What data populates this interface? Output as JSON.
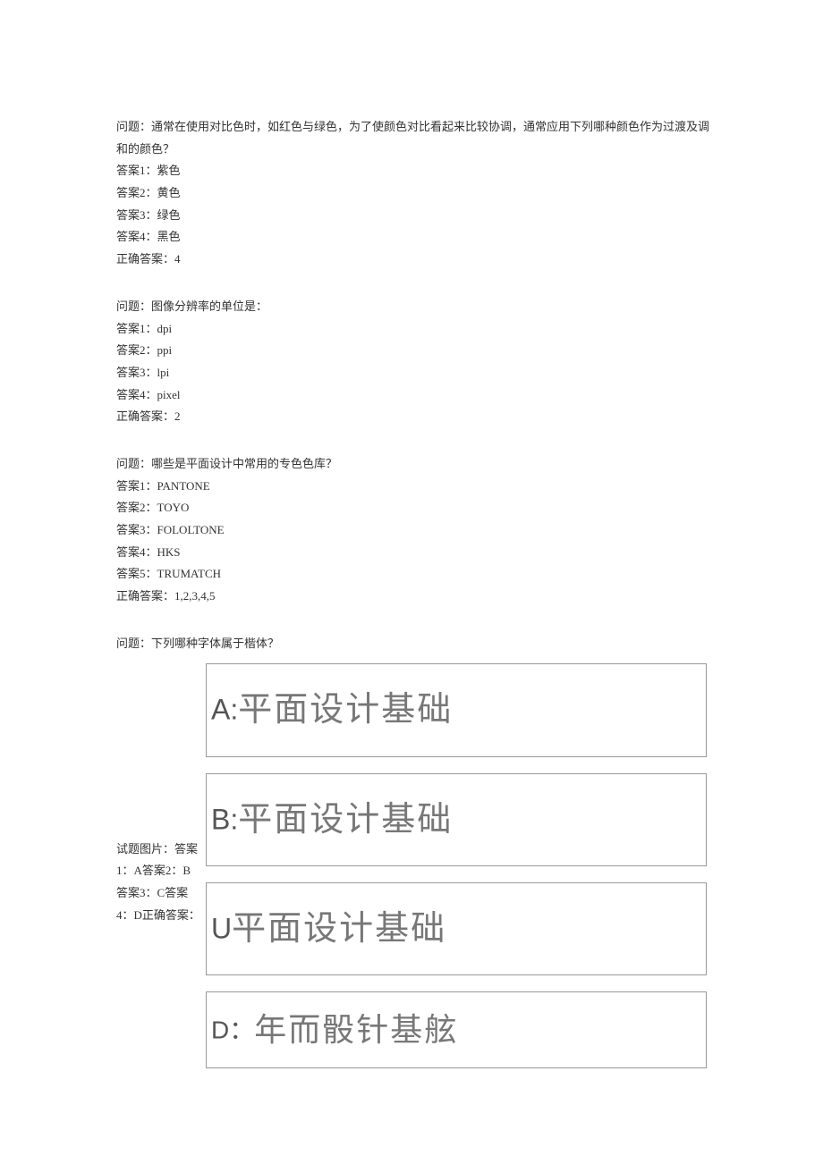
{
  "q1": {
    "question": "问题：通常在使用对比色时，如红色与绿色，为了使颜色对比看起来比较协调，通常应用下列哪种颜色作为过渡及调和的颜色？",
    "a1": "答案1：紫色",
    "a2": "答案2：黄色",
    "a3": "答案3：绿色",
    "a4": "答案4：黑色",
    "correct": "正确答案：4"
  },
  "q2": {
    "question": "问题：图像分辨率的单位是：",
    "a1": "答案1：dpi",
    "a2": "答案2：ppi",
    "a3": "答案3：lpi",
    "a4": "答案4：pixel",
    "correct": "正确答案：2"
  },
  "q3": {
    "question": "问题：哪些是平面设计中常用的专色色库？",
    "a1": "答案1：PANTONE",
    "a2": "答案2：TOYO",
    "a3": "答案3：FOLOLTONE",
    "a4": "答案4：HKS",
    "a5": "答案5：TRUMATCH",
    "correct": "正确答案：1,2,3,4,5"
  },
  "q4": {
    "question": "问题：下列哪种字体属于楷体？",
    "sample_a_label": "A:",
    "sample_a_text": "平面设计基础",
    "sample_b_label": "B:",
    "sample_b_text": "平面设计基础",
    "sample_c_label": "U",
    "sample_c_text": "平面设计基础",
    "sample_d_label": "D：",
    "sample_d_text": "年而骰针基舷",
    "bottom_text": "试题图片：答案1：A答案2：B答案3：C答案4：D正确答案："
  }
}
